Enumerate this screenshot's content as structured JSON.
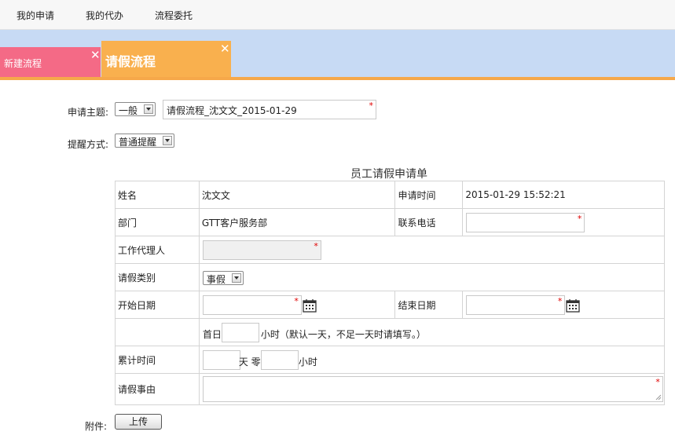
{
  "topnav": {
    "items": [
      "我的申请",
      "我的代办",
      "流程委托"
    ]
  },
  "tabs": [
    {
      "label": "新建流程",
      "close": "✕"
    },
    {
      "label": "请假流程",
      "close": "✕"
    }
  ],
  "form": {
    "subject_label": "申请主题:",
    "priority_value": "一般",
    "subject_value": "请假流程_沈文文_2015-01-29",
    "remind_label": "提醒方式:",
    "remind_value": "普通提醒",
    "required_mark": "*",
    "title": "员工请假申请单",
    "rows": {
      "name_label": "姓名",
      "name_value": "沈文文",
      "apply_time_label": "申请时间",
      "apply_time_value": "2015-01-29 15:52:21",
      "dept_label": "部门",
      "dept_value": "GTT客户服务部",
      "phone_label": "联系电话",
      "agent_label": "工作代理人",
      "type_label": "请假类别",
      "type_value": "事假",
      "start_label": "开始日期",
      "end_label": "结束日期",
      "first_day_label": "首日",
      "first_day_hint": "小时（默认一天，不足一天时请填写。）",
      "total_label": "累计时间",
      "days_unit": "天 零",
      "hours_unit": "小时",
      "reason_label": "请假事由"
    },
    "attach_label": "附件:",
    "upload_label": "上传"
  },
  "colors": {
    "tab_new": "#f46a86",
    "tab_active": "#f9b04e",
    "tabbar_bg": "#c7daf4",
    "required": "#e00000"
  }
}
